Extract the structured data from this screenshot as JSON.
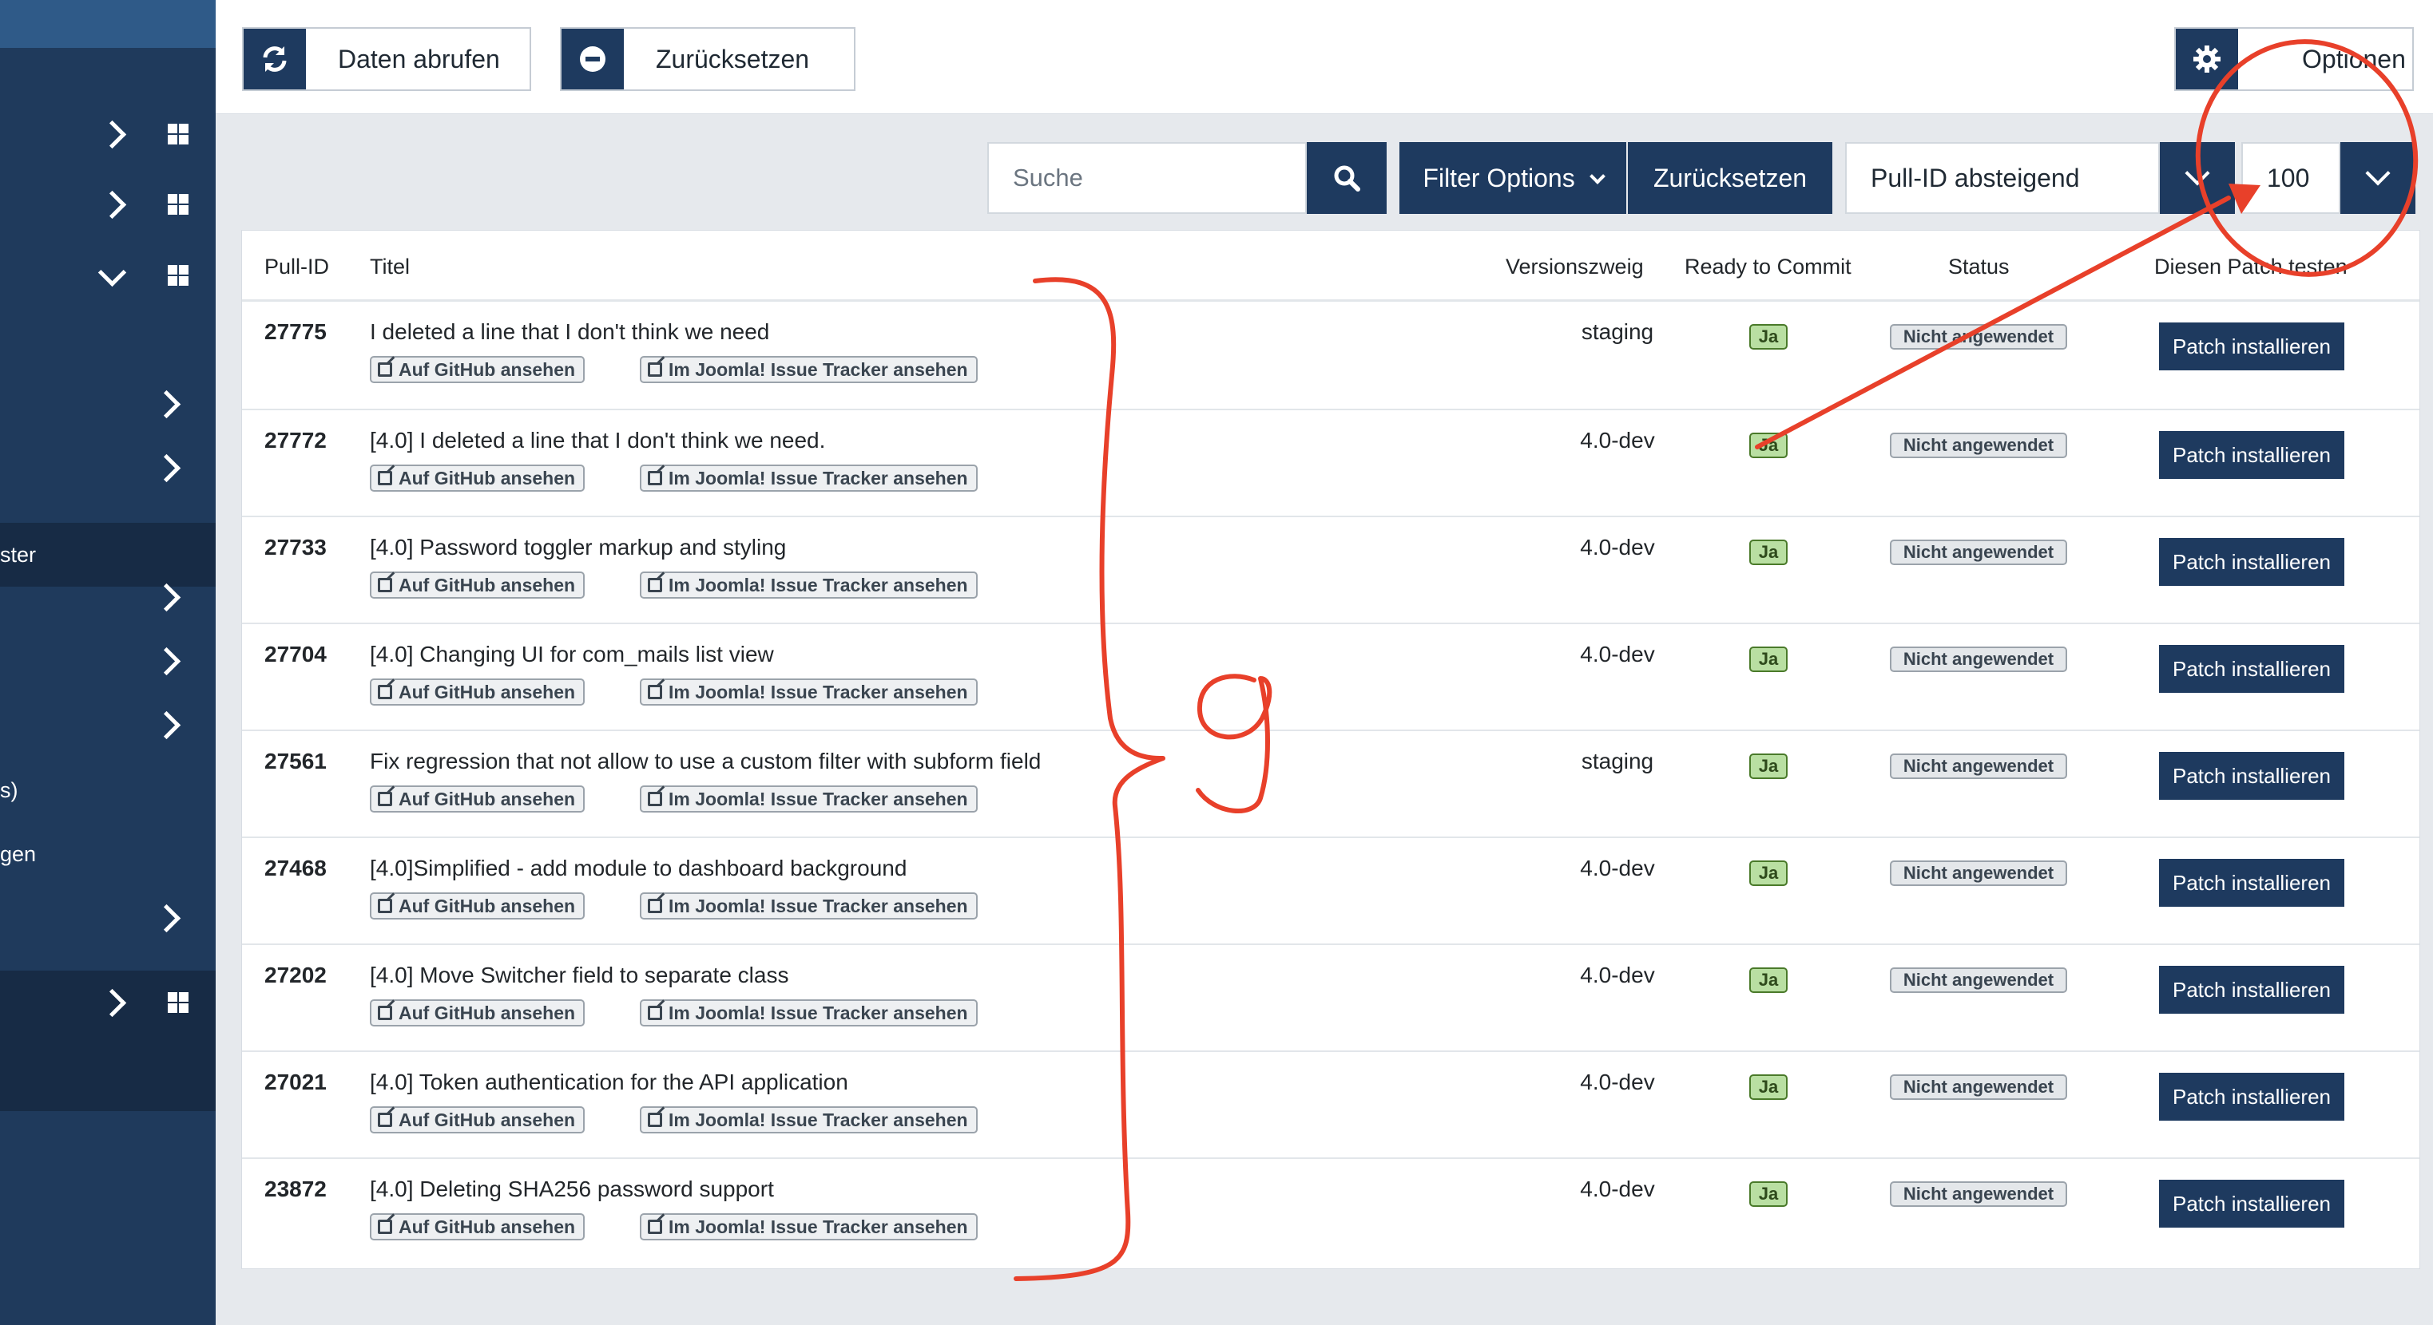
{
  "sidebar": {
    "items": [
      {
        "label": "",
        "icon": "chevron-right-icon"
      },
      {
        "label": "",
        "icon": "chevron-right-icon"
      },
      {
        "label": "",
        "icon": "chevron-down-icon"
      },
      {
        "label": "",
        "icon": "chevron-right-icon"
      },
      {
        "label": "",
        "icon": "chevron-right-icon"
      },
      {
        "label": "ster",
        "icon": ""
      },
      {
        "label": "",
        "icon": "chevron-right-icon"
      },
      {
        "label": "",
        "icon": "chevron-right-icon"
      },
      {
        "label": "",
        "icon": "chevron-right-icon"
      },
      {
        "label": "s)",
        "icon": ""
      },
      {
        "label": "gen",
        "icon": ""
      },
      {
        "label": "",
        "icon": "chevron-right-icon"
      },
      {
        "label": "",
        "icon": "chevron-right-icon"
      }
    ]
  },
  "toolbar": {
    "fetch_label": "Daten abrufen",
    "reset_label": "Zurücksetzen",
    "options_label": "Optionen"
  },
  "filters": {
    "search_placeholder": "Suche",
    "filter_options_label": "Filter Options",
    "reset_label": "Zurücksetzen",
    "sort_value": "Pull-ID absteigend",
    "limit_value": "100"
  },
  "table": {
    "headers": {
      "pull_id": "Pull-ID",
      "title": "Titel",
      "branch": "Versionszweig",
      "rtc": "Ready to Commit",
      "status": "Status",
      "test": "Diesen Patch testen"
    },
    "github_link": "Auf GitHub ansehen",
    "tracker_link": "Im Joomla! Issue Tracker ansehen",
    "patch_button": "Patch installieren",
    "rows": [
      {
        "id": "27775",
        "title": "I deleted a line that I don't think we need",
        "branch": "staging",
        "rtc": "Ja",
        "status": "Nicht angewendet"
      },
      {
        "id": "27772",
        "title": "[4.0] I deleted a line that I don't think we need.",
        "branch": "4.0-dev",
        "rtc": "Ja",
        "status": "Nicht angewendet"
      },
      {
        "id": "27733",
        "title": "[4.0] Password toggler markup and styling",
        "branch": "4.0-dev",
        "rtc": "Ja",
        "status": "Nicht angewendet"
      },
      {
        "id": "27704",
        "title": "[4.0] Changing UI for com_mails list view",
        "branch": "4.0-dev",
        "rtc": "Ja",
        "status": "Nicht angewendet"
      },
      {
        "id": "27561",
        "title": "Fix regression that not allow to use a custom filter with subform field",
        "branch": "staging",
        "rtc": "Ja",
        "status": "Nicht angewendet"
      },
      {
        "id": "27468",
        "title": "[4.0]Simplified - add module to dashboard background",
        "branch": "4.0-dev",
        "rtc": "Ja",
        "status": "Nicht angewendet"
      },
      {
        "id": "27202",
        "title": "[4.0] Move Switcher field to separate class",
        "branch": "4.0-dev",
        "rtc": "Ja",
        "status": "Nicht angewendet"
      },
      {
        "id": "27021",
        "title": "[4.0] Token authentication for the API application",
        "branch": "4.0-dev",
        "rtc": "Ja",
        "status": "Nicht angewendet"
      },
      {
        "id": "23872",
        "title": "[4.0] Deleting SHA256 password support",
        "branch": "4.0-dev",
        "rtc": "Ja",
        "status": "Nicht angewendet"
      }
    ]
  },
  "annotation": {
    "count_label": "9",
    "color": "#e8402a"
  },
  "colors": {
    "primary": "#1e3a5f",
    "sidebar": "#1f3a5c",
    "success_badge": "#b9dfa2"
  }
}
